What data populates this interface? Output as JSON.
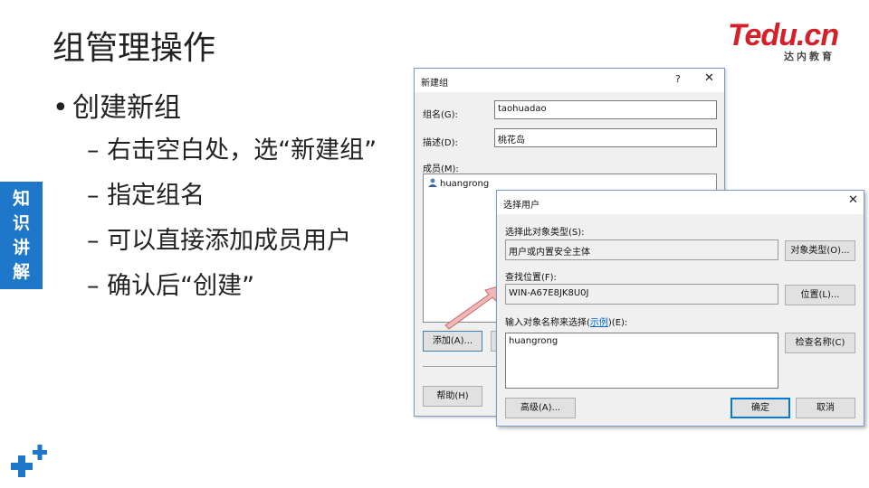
{
  "slide": {
    "title": "组管理操作",
    "bullet_marker": "•",
    "bullet": "创建新组",
    "sub_items": [
      "– 右击空白处，选“新建组”",
      "– 指定组名",
      "– 可以直接添加成员用户",
      "– 确认后“创建”"
    ],
    "side_tag": [
      "知",
      "识",
      "讲",
      "解"
    ]
  },
  "logo": {
    "text_t": "T",
    "text_rest": "edu.cn",
    "sub": "达内教育"
  },
  "new_group_dialog": {
    "title": "新建组",
    "help_glyph": "?",
    "close_glyph": "✕",
    "group_name_label": "组名(G):",
    "group_name_value": "taohuadao",
    "description_label": "描述(D):",
    "description_value": "桃花岛",
    "members_label": "成员(M):",
    "members": [
      "huangrong"
    ],
    "add_button": "添加(A)...",
    "help_button": "帮助(H)"
  },
  "select_users_dialog": {
    "title": "选择用户",
    "close_glyph": "✕",
    "object_type_label": "选择此对象类型(S):",
    "object_type_value": "用户或内置安全主体",
    "object_type_button": "对象类型(O)...",
    "location_label": "查找位置(F):",
    "location_value": "WIN-A67E8JK8U0J",
    "location_button": "位置(L)...",
    "enter_names_label_prefix": "输入对象名称来选择(",
    "enter_names_link": "示例",
    "enter_names_label_suffix": ")(E):",
    "names_value": "huangrong",
    "check_names_button": "检查名称(C)",
    "advanced_button": "高级(A)...",
    "ok_button": "确定",
    "cancel_button": "取消"
  },
  "colors": {
    "brand_red": "#d32029",
    "side_tag_blue": "#1f77c9",
    "dialog_border": "#7a9cc6",
    "arrow_pink": "#f2b8b8"
  }
}
